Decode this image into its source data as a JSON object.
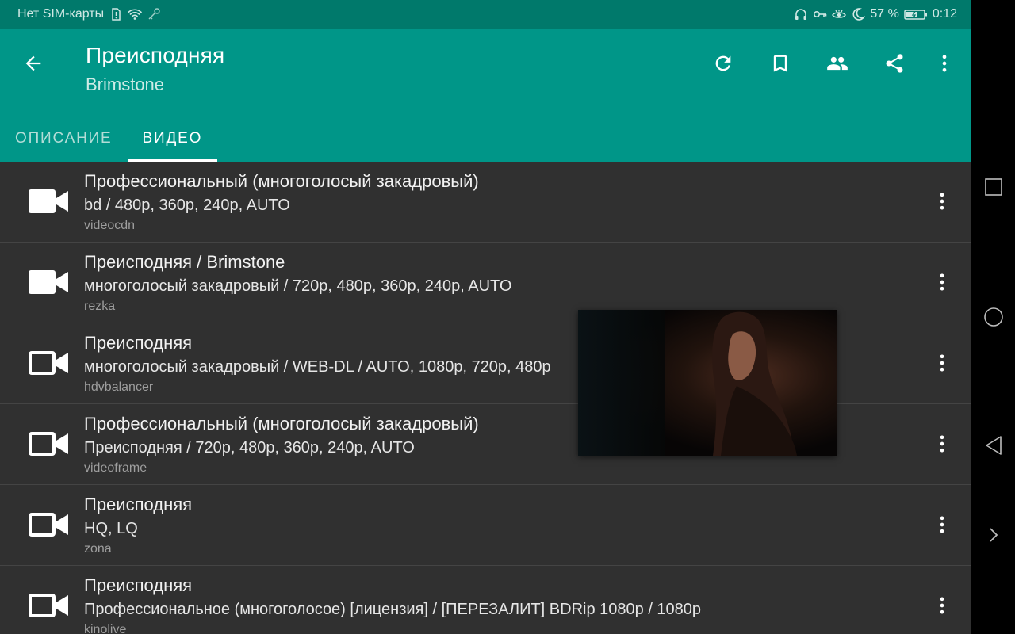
{
  "status_bar": {
    "carrier": "Нет SIM-карты",
    "battery": "57 %",
    "time": "0:12"
  },
  "app_bar": {
    "title": "Преисподняя",
    "subtitle": "Brimstone",
    "actions": [
      "refresh-icon",
      "bookmark-icon",
      "people-icon",
      "share-icon",
      "more-vert-icon"
    ]
  },
  "tabs": [
    {
      "label": "ОПИСАНИЕ",
      "active": false
    },
    {
      "label": "ВИДЕО",
      "active": true
    }
  ],
  "videos": [
    {
      "title": "Профессиональный (многоголосый закадровый)",
      "details": "bd / 480p, 360p, 240p, AUTO",
      "source": "videocdn",
      "icon": "videocam-filled-icon"
    },
    {
      "title": "Преисподняя / Brimstone",
      "details": "многоголосый закадровый / 720p, 480p, 360p, 240p, AUTO",
      "source": "rezka",
      "icon": "videocam-filled-icon"
    },
    {
      "title": "Преисподняя",
      "details": "многоголосый закадровый / WEB-DL / AUTO, 1080p, 720p, 480p",
      "source": "hdvbalancer",
      "icon": "videocam-outline-icon"
    },
    {
      "title": "Профессиональный (многоголосый закадровый)",
      "details": "Преисподняя / 720p, 480p, 360p, 240p, AUTO",
      "source": "videoframe",
      "icon": "videocam-outline-icon"
    },
    {
      "title": "Преисподняя",
      "details": "HQ, LQ",
      "source": "zona",
      "icon": "videocam-outline-icon"
    },
    {
      "title": "Преисподняя",
      "details": "Профессиональное (многоголосое) [лицензия] / [ПЕРЕЗАЛИТ] BDRip 1080p / 1080p",
      "source": "kinolive",
      "icon": "videocam-outline-icon"
    }
  ],
  "colors": {
    "status_bar": "#00796b",
    "app_bar": "#009688",
    "list_bg": "#303030",
    "divider": "#444444"
  }
}
